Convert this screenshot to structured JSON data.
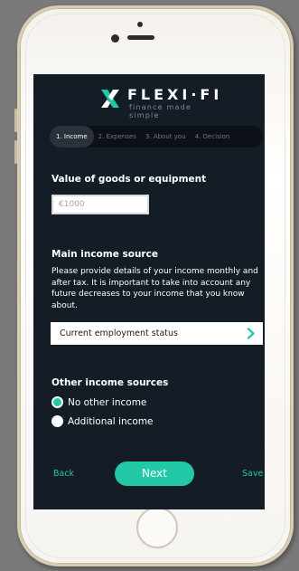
{
  "brand": {
    "name": "FLEXI·FI",
    "tagline": "finance made simple",
    "accent_color": "#23c9a6"
  },
  "steps": [
    {
      "label": "1. Income",
      "active": true
    },
    {
      "label": "2. Expenses",
      "active": false
    },
    {
      "label": "3. About you",
      "active": false
    },
    {
      "label": "4. Decision",
      "active": false
    }
  ],
  "goods": {
    "title": "Value of goods or equipment",
    "placeholder": "€1000",
    "value": ""
  },
  "main_income": {
    "title": "Main income source",
    "description": "Please provide details of your income monthly and after tax.  It is important to take into account any future decreases to your income that you know about.",
    "select_label": "Current employment status",
    "select_icon": "chevron-right-icon"
  },
  "other_income": {
    "title": "Other income sources",
    "options": [
      {
        "label": "No other income",
        "checked": true
      },
      {
        "label": "Additional income",
        "checked": false
      }
    ]
  },
  "footer": {
    "back_label": "Back",
    "next_label": "Next",
    "save_label": "Save"
  }
}
